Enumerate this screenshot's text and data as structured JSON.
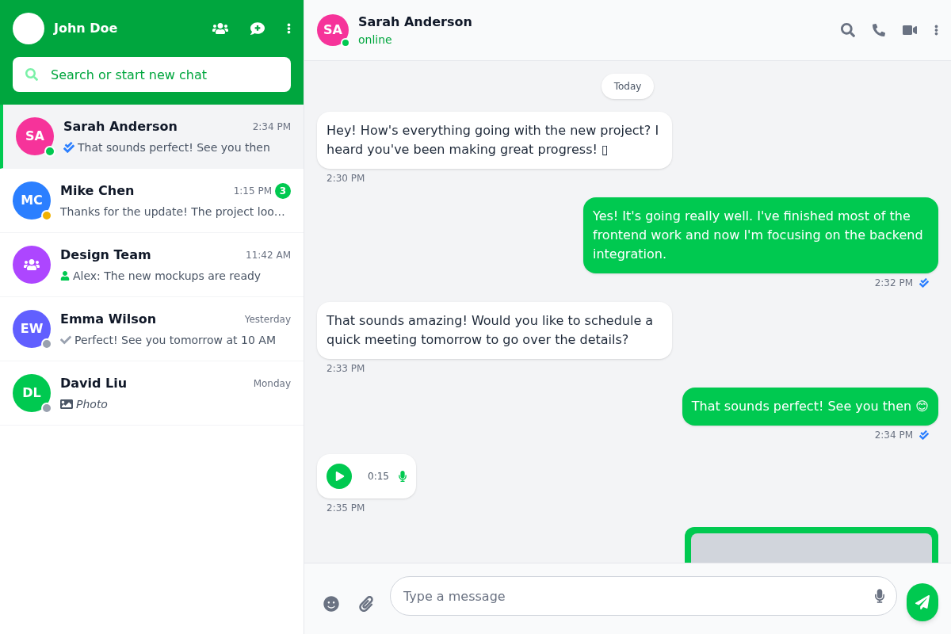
{
  "sidebar": {
    "profile": {
      "name": "John Doe"
    },
    "search": {
      "placeholder": "Search or start new chat"
    },
    "chats": [
      {
        "kind": "contact",
        "initials": "SA",
        "color": "#f6339a",
        "presence": {
          "color": "#00c950"
        },
        "name": "Sarah Anderson",
        "time": "2:34 PM",
        "preview": {
          "kind": "receipt",
          "read": true,
          "text": "That sounds perfect! See you then"
        },
        "selected": true
      },
      {
        "kind": "contact",
        "initials": "MC",
        "color": "#2b7fff",
        "presence": {
          "color": "#f0b100"
        },
        "name": "Mike Chen",
        "time": "1:15 PM",
        "unread": "3",
        "preview": {
          "kind": "plain",
          "text": "Thanks for the update! The project loo…"
        },
        "selected": false
      },
      {
        "kind": "group",
        "color": "#ad46ff",
        "name": "Design Team",
        "time": "11:42 AM",
        "preview": {
          "kind": "member",
          "text": "Alex: The new mockups are ready"
        },
        "selected": false
      },
      {
        "kind": "contact",
        "initials": "EW",
        "color": "#615fff",
        "presence": {
          "color": "#99a1af"
        },
        "name": "Emma Wilson",
        "time": "Yesterday",
        "preview": {
          "kind": "receipt",
          "read": false,
          "text": "Perfect! See you tomorrow at 10 AM"
        },
        "selected": false
      },
      {
        "kind": "contact",
        "initials": "DL",
        "color": "#00c950",
        "presence": {
          "color": "#99a1af"
        },
        "name": "David Liu",
        "time": "Monday",
        "preview": {
          "kind": "photo",
          "text": "Photo"
        },
        "selected": false
      }
    ]
  },
  "chat": {
    "header": {
      "initials": "SA",
      "color": "#f6339a",
      "presence": {
        "color": "#00c950"
      },
      "name": "Sarah Anderson",
      "status": "online"
    },
    "date_label": "Today",
    "messages": [
      {
        "kind": "text",
        "outgoing": false,
        "text": "Hey! How's everything going with the new project? I heard you've been making great progress! ▯",
        "time": "2:30 PM"
      },
      {
        "kind": "text",
        "outgoing": true,
        "text": "Yes! It's going really well. I've finished most of the frontend work and now I'm focusing on the backend integration.",
        "time": "2:32 PM",
        "read": true
      },
      {
        "kind": "text",
        "outgoing": false,
        "text": "That sounds amazing! Would you like to schedule a quick meeting tomorrow to go over the details?",
        "time": "2:33 PM"
      },
      {
        "kind": "text",
        "outgoing": true,
        "text": "That sounds perfect! See you then 😊",
        "time": "2:34 PM",
        "read": true
      },
      {
        "kind": "voice",
        "outgoing": false,
        "duration": "0:15",
        "time": "2:35 PM"
      },
      {
        "kind": "image",
        "outgoing": true
      }
    ],
    "composer": {
      "placeholder": "Type a message"
    }
  }
}
